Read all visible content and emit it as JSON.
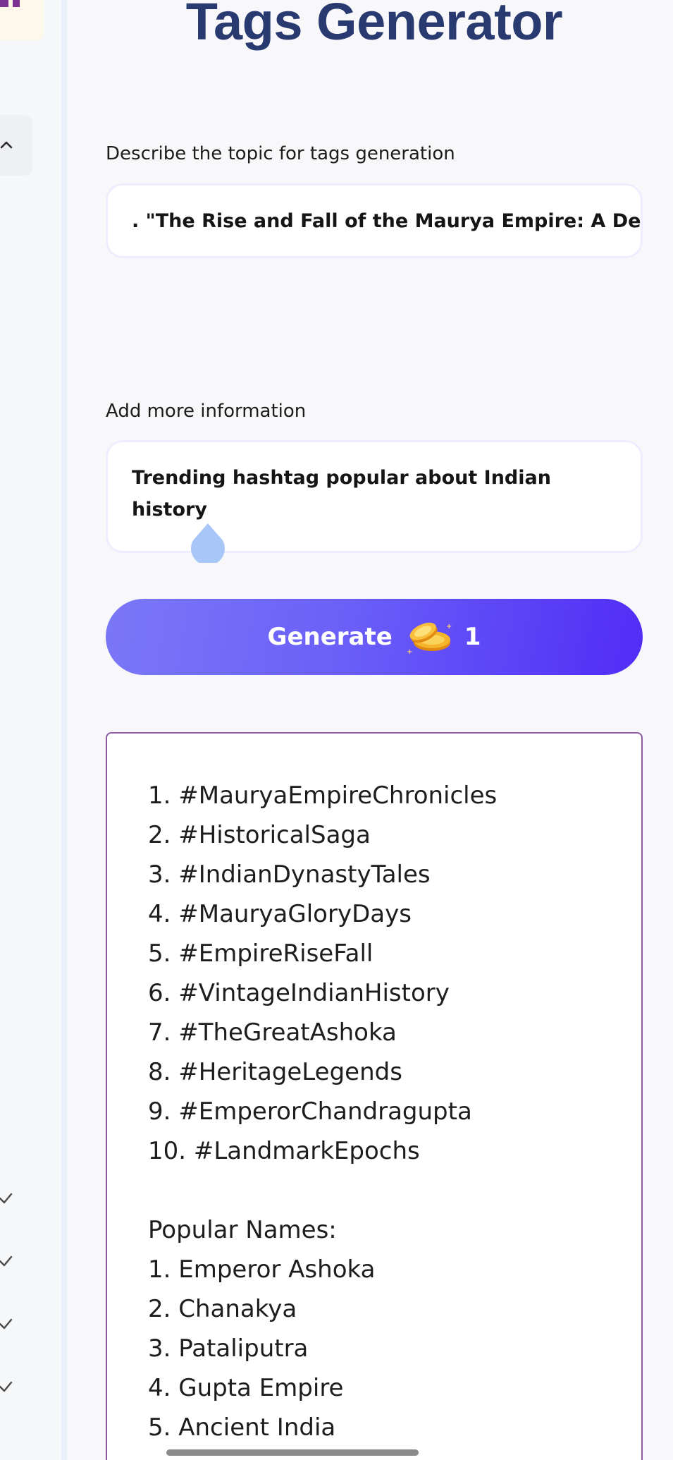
{
  "page": {
    "title": "Tags Generator"
  },
  "form": {
    "topic_label": "Describe the topic for tags generation",
    "topic_value": ". \"The Rise and Fall of the Maurya Empire: A Detailed",
    "info_label": "Add more information",
    "info_value": "Trending hashtag popular about Indian history",
    "generate_label": "Generate",
    "generate_cost": "1"
  },
  "output": {
    "hashtags": [
      "1. #MauryaEmpireChronicles",
      "2. #HistoricalSaga",
      "3. #IndianDynastyTales",
      "4. #MauryaGloryDays",
      "5. #EmpireRiseFall",
      "6. #VintageIndianHistory",
      "7. #TheGreatAshoka",
      "8. #HeritageLegends",
      "9. #EmperorChandragupta",
      "10. #LandmarkEpochs"
    ],
    "names_heading": "Popular Names:",
    "names": [
      "1. Emperor Ashoka",
      "2. Chanakya",
      "3. Pataliputra",
      "4. Gupta Empire",
      "5. Ancient India"
    ]
  },
  "icons": {
    "collapse": "chevron-up-icon",
    "checks": [
      "check-icon",
      "check-icon",
      "check-icon",
      "check-icon"
    ],
    "coin": "coins-icon",
    "cursor": "text-cursor-drop-icon"
  },
  "colors": {
    "title": "#283a6f",
    "button_start": "#7b78f7",
    "button_end": "#512cf6",
    "output_border": "#8d5a9f",
    "drop_handle": "#a9c6f9"
  }
}
